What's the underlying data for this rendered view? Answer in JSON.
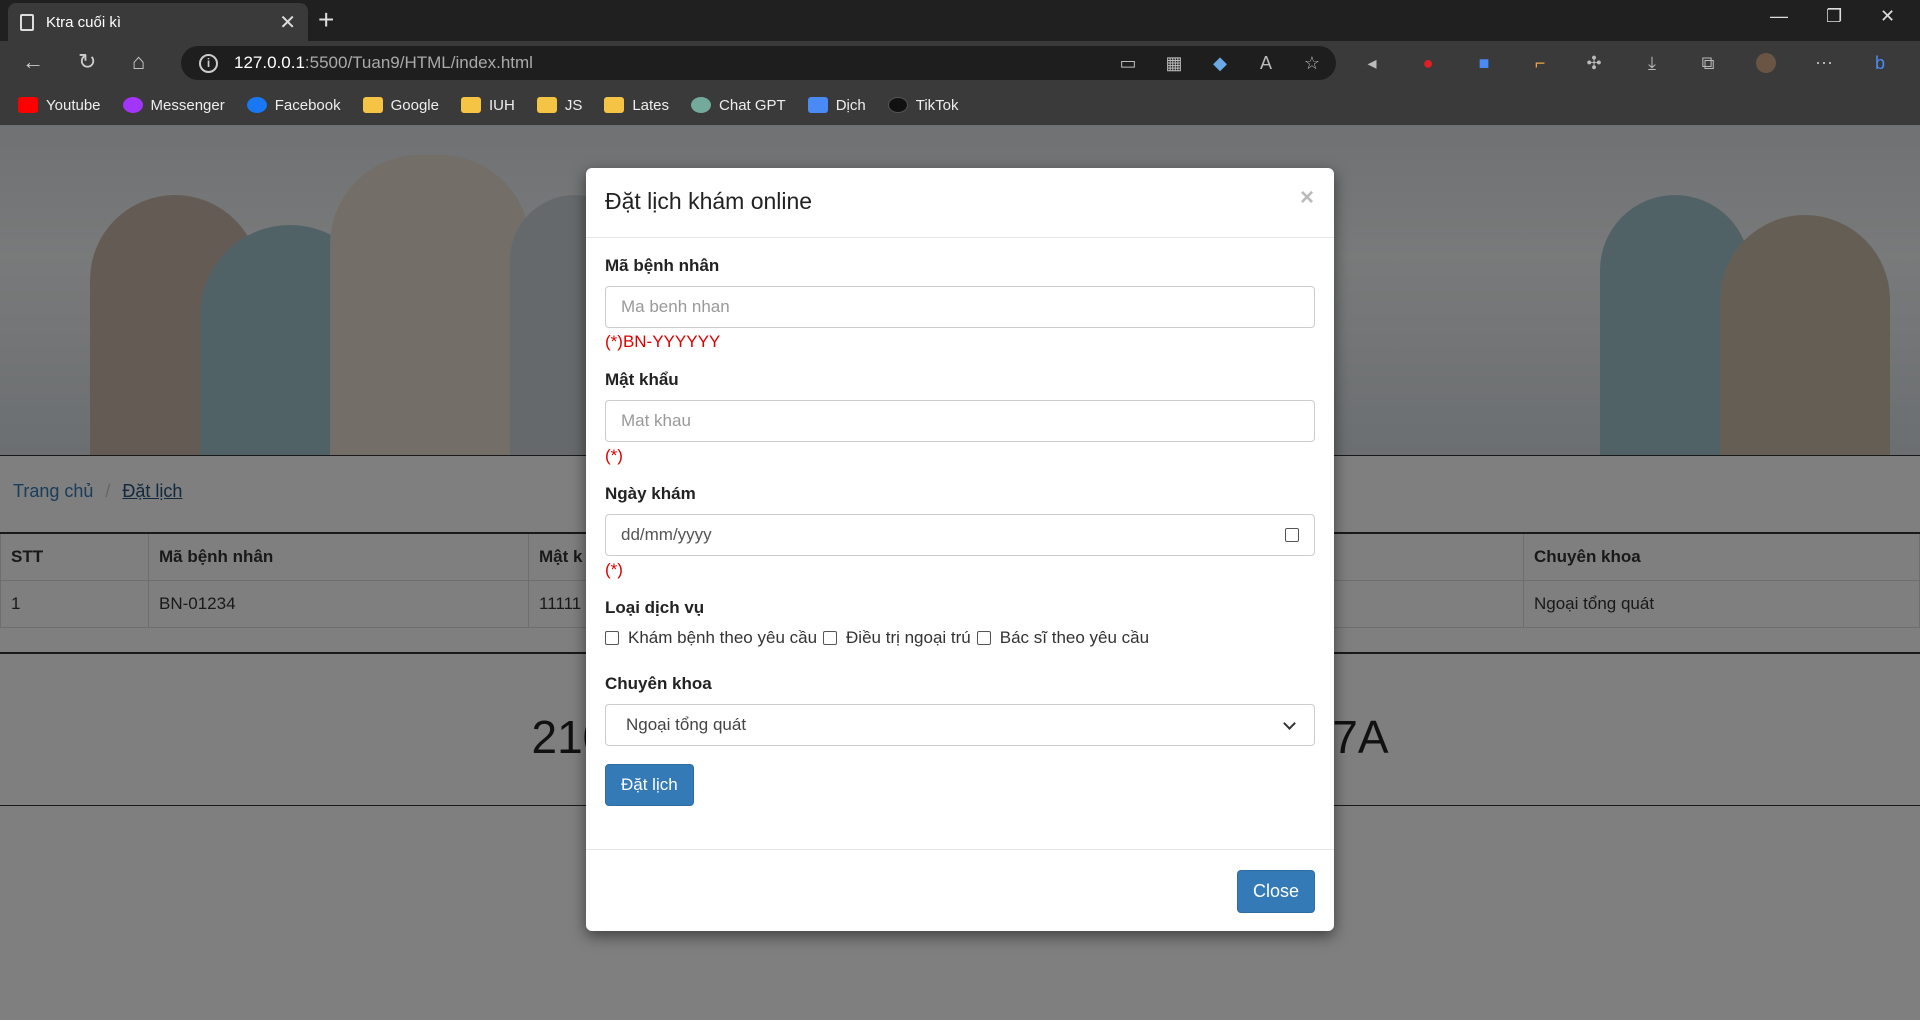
{
  "browser": {
    "tab_title": "Ktra cuối kì",
    "url_host": "127.0.0.1",
    "url_path": ":5500/Tuan9/HTML/index.html",
    "bookmarks": [
      {
        "label": "Youtube",
        "color": "#ff0000"
      },
      {
        "label": "Messenger",
        "color": "#a334fa"
      },
      {
        "label": "Facebook",
        "color": "#1877f2"
      },
      {
        "label": "Google",
        "color": "#f6c445"
      },
      {
        "label": "IUH",
        "color": "#f6c445"
      },
      {
        "label": "JS",
        "color": "#f6c445"
      },
      {
        "label": "Lates",
        "color": "#f6c445"
      },
      {
        "label": "Chat GPT",
        "color": "#74aa9c"
      },
      {
        "label": "Dịch",
        "color": "#4a8af4"
      },
      {
        "label": "TikTok",
        "color": "#111111"
      }
    ]
  },
  "page": {
    "breadcrumb": {
      "home": "Trang chủ",
      "current": "Đặt lịch"
    },
    "table": {
      "headers": [
        "STT",
        "Mã bệnh nhân",
        "Mật k",
        "",
        "Chuyên khoa"
      ],
      "rows": [
        [
          "1",
          "BN-01234",
          "11111",
          "",
          "Ngoại tổng quát"
        ]
      ]
    },
    "footer_left": "210",
    "footer_right": "7A"
  },
  "modal": {
    "title": "Đặt lịch khám online",
    "close_x": "×",
    "patient_id": {
      "label": "Mã bệnh nhân",
      "placeholder": "Ma benh nhan",
      "hint": "(*)BN-YYYYYY"
    },
    "password": {
      "label": "Mật khẩu",
      "placeholder": "Mat khau",
      "hint": "(*)"
    },
    "date": {
      "label": "Ngày khám",
      "placeholder": "dd/mm/yyyy",
      "hint": "(*)"
    },
    "service": {
      "label": "Loại dịch vụ",
      "options": [
        "Khám bệnh theo yêu cầu",
        "Điều trị ngoại trú",
        "Bác sĩ theo yêu cầu"
      ]
    },
    "specialty": {
      "label": "Chuyên khoa",
      "selected": "Ngoại tổng quát"
    },
    "submit_label": "Đặt lịch",
    "close_label": "Close"
  }
}
